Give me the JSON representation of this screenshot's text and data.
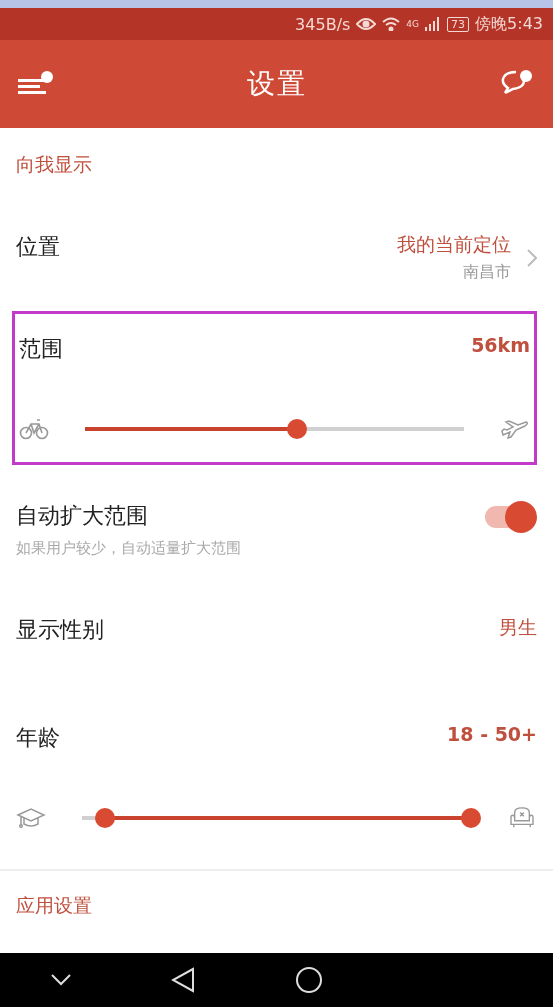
{
  "status_bar": {
    "speed": "345B/s",
    "network": "4G",
    "battery": "73",
    "time": "傍晚5:43"
  },
  "app_bar": {
    "title": "设置",
    "menu_badge": true,
    "chat_badge": true
  },
  "sections": [
    {
      "header": "向我显示",
      "rows": [
        {
          "kind": "location",
          "label": "位置",
          "value": "我的当前定位",
          "detail": "南昌市"
        },
        {
          "kind": "slider",
          "label": "范围",
          "value": "56km",
          "highlighted": true,
          "thumbs": [
            {
              "level": 0.56
            }
          ]
        },
        {
          "kind": "toggle",
          "label": "自动扩大范围",
          "description": "如果用户较少，自动适量扩大范围",
          "on": true
        },
        {
          "kind": "value",
          "label": "显示性别",
          "value": "男生"
        },
        {
          "kind": "slider",
          "label": "年龄",
          "value": "18 - 50+",
          "highlighted": false,
          "thumbs": [
            {
              "level": 0.06
            },
            {
              "level": 1
            }
          ]
        }
      ]
    },
    {
      "header": "应用设置"
    }
  ]
}
